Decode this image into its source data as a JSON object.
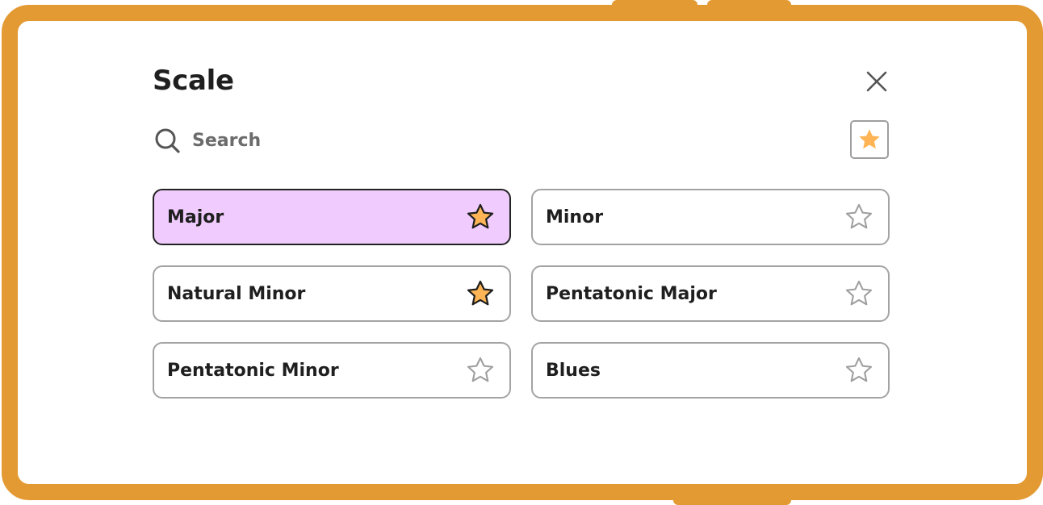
{
  "dialog": {
    "title": "Scale",
    "search_placeholder": "Search",
    "close_icon": "close-icon",
    "favorites_filter_icon": "star-filled-icon"
  },
  "colors": {
    "frame": "#E39A32",
    "selected_background": "#F0CBFD",
    "star_filled": "#FFB555",
    "star_outline": "#9e9e9e"
  },
  "options": [
    {
      "label": "Major",
      "favorite": true,
      "selected": true
    },
    {
      "label": "Minor",
      "favorite": false,
      "selected": false
    },
    {
      "label": "Natural Minor",
      "favorite": true,
      "selected": false
    },
    {
      "label": "Pentatonic Major",
      "favorite": false,
      "selected": false
    },
    {
      "label": "Pentatonic Minor",
      "favorite": false,
      "selected": false
    },
    {
      "label": "Blues",
      "favorite": false,
      "selected": false
    }
  ]
}
